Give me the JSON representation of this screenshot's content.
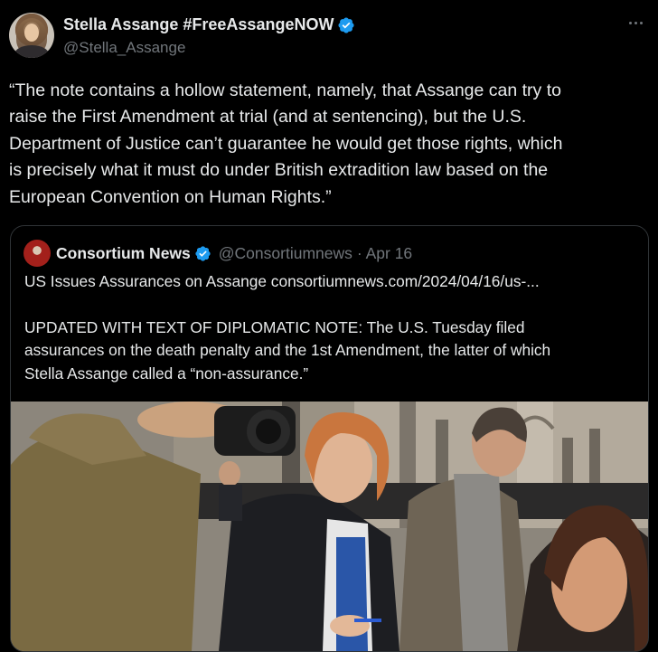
{
  "author": {
    "display_name": "Stella Assange #FreeAssangeNOW",
    "handle": "@Stella_Assange",
    "verified": true,
    "verified_color": "#1d9bf0"
  },
  "tweet": {
    "text": "“The note contains a hollow statement, namely, that Assange can try to\nraise the First Amendment at trial (and at sentencing), but the U.S.\nDepartment of Justice can’t guarantee he would get those rights, which\nis precisely what it must do under British extradition law based on the\nEuropean Convention on Human Rights.”"
  },
  "more_icon": "more-horizontal-icon",
  "quoted": {
    "display_name": "Consortium News",
    "handle": "@Consortiumnews",
    "date": "· Apr 16",
    "verified": true,
    "text": "US Issues Assurances on Assange consortiumnews.com/2024/04/16/us-...\n\nUPDATED WITH TEXT OF DIPLOMATIC NOTE: The U.S. Tuesday filed\nassurances on the death penalty and the 1st Amendment, the latter of which\nStella Assange called a “non-assurance.”"
  },
  "colors": {
    "background": "#000000",
    "text": "#e7e9ea",
    "secondary_text": "#71767b",
    "border": "#2f3336"
  }
}
